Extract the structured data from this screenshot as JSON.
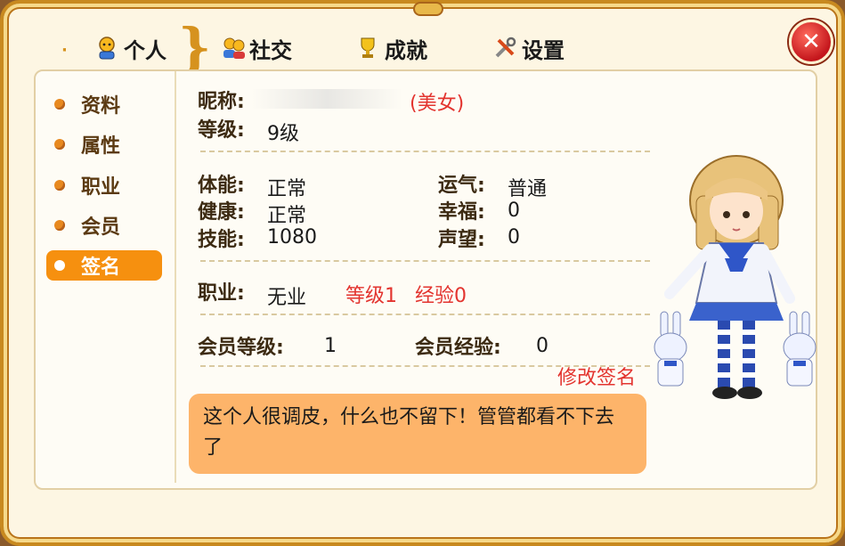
{
  "tabs": [
    {
      "label": "个人",
      "icon": "person-icon",
      "active": true
    },
    {
      "label": "社交",
      "icon": "friends-icon",
      "active": false
    },
    {
      "label": "成就",
      "icon": "trophy-icon",
      "active": false
    },
    {
      "label": "设置",
      "icon": "tools-icon",
      "active": false
    }
  ],
  "sidebar": {
    "items": [
      {
        "label": "资料"
      },
      {
        "label": "属性"
      },
      {
        "label": "职业"
      },
      {
        "label": "会员"
      },
      {
        "label": "签名",
        "active": true
      }
    ]
  },
  "profile": {
    "nickname_label": "昵称:",
    "nickname_value": "",
    "gender_tag": "(美女)",
    "level_label": "等级:",
    "level_value": "9级"
  },
  "stats": {
    "stamina_label": "体能:",
    "stamina_value": "正常",
    "health_label": "健康:",
    "health_value": "正常",
    "skill_label": "技能:",
    "skill_value": "1080",
    "luck_label": "运气:",
    "luck_value": "普通",
    "happiness_label": "幸福:",
    "happiness_value": "0",
    "reputation_label": "声望:",
    "reputation_value": "0"
  },
  "career": {
    "label": "职业:",
    "value": "无业",
    "level": "等级1",
    "exp": "经验0"
  },
  "membership": {
    "level_label": "会员等级:",
    "level_value": "1",
    "exp_label": "会员经验:",
    "exp_value": "0"
  },
  "signature": {
    "edit_link": "修改签名",
    "text": "这个人很调皮，什么也不留下！管管都看不下去了"
  },
  "close_label": "✕",
  "colors": {
    "accent": "#f6900f",
    "frame": "#c8891f",
    "highlight_red": "#e3342f",
    "signature_bg": "#fdb46a"
  }
}
